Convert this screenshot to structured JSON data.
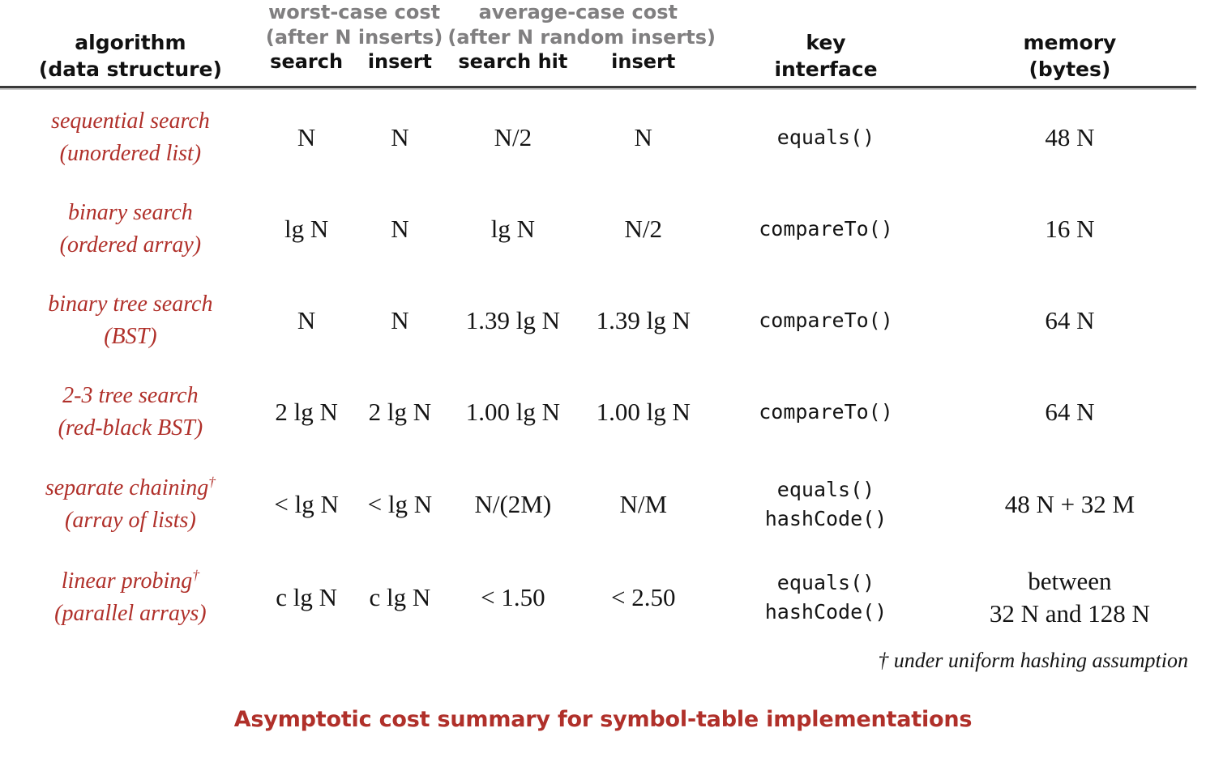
{
  "table": {
    "columns": {
      "algorithm": {
        "line1": "algorithm",
        "line2": "(data structure)"
      },
      "worst_case": {
        "title": "worst-case cost",
        "subtitle": "(after N inserts)"
      },
      "average_case": {
        "title": "average-case cost",
        "subtitle": "(after N random inserts)"
      },
      "worst_search": "search",
      "worst_insert": "insert",
      "avg_search_hit": "search hit",
      "avg_insert": "insert",
      "key_interface": {
        "line1": "key",
        "line2": "interface"
      },
      "memory": {
        "line1": "memory",
        "line2": "(bytes)"
      }
    },
    "rows": [
      {
        "algorithm": "sequential search",
        "structure": "(unordered list)",
        "dagger": "",
        "worst_search": "N",
        "worst_search_italic": "N",
        "worst_insert": "N",
        "avg_search_hit": "N/2",
        "avg_insert": "N",
        "key_interface_1": "equals()",
        "key_interface_2": "",
        "memory_1": "48 N",
        "memory_2": ""
      },
      {
        "algorithm": "binary search",
        "structure": "(ordered array)",
        "dagger": "",
        "worst_search": "lg N",
        "worst_insert": "N",
        "avg_search_hit": "lg N",
        "avg_insert": "N/2",
        "key_interface_1": "compareTo()",
        "key_interface_2": "",
        "memory_1": "16 N",
        "memory_2": ""
      },
      {
        "algorithm": "binary tree search",
        "structure": "(BST)",
        "dagger": "",
        "worst_search": "N",
        "worst_insert": "N",
        "avg_search_hit": "1.39 lg N",
        "avg_insert": "1.39 lg N",
        "key_interface_1": "compareTo()",
        "key_interface_2": "",
        "memory_1": "64 N",
        "memory_2": ""
      },
      {
        "algorithm": "2-3 tree search",
        "structure": "(red-black BST)",
        "dagger": "",
        "worst_search": "2 lg N",
        "worst_insert": "2 lg N",
        "avg_search_hit": "1.00 lg N",
        "avg_insert": "1.00 lg N",
        "key_interface_1": "compareTo()",
        "key_interface_2": "",
        "memory_1": "64 N",
        "memory_2": ""
      },
      {
        "algorithm": "separate chaining",
        "structure": "(array of lists)",
        "dagger": "†",
        "worst_search": "< lg N",
        "worst_insert": "< lg N",
        "avg_search_hit": "N/(2M)",
        "avg_insert": "N/M",
        "key_interface_1": "equals()",
        "key_interface_2": "hashCode()",
        "memory_1": "48 N + 32 M",
        "memory_2": ""
      },
      {
        "algorithm": "linear probing",
        "structure": "(parallel arrays)",
        "dagger": "†",
        "worst_search": "c lg N",
        "worst_insert": "c lg N",
        "avg_search_hit": "< 1.50",
        "avg_insert": "< 2.50",
        "key_interface_1": "equals()",
        "key_interface_2": "hashCode()",
        "memory_1": "between",
        "memory_2": "32 N and 128 N"
      }
    ]
  },
  "footnote": "† under uniform hashing assumption",
  "caption": "Asymptotic cost summary for symbol-table implementations",
  "colors": {
    "accent_red": "#b0302a",
    "header_gray": "#807f80",
    "text_black": "#141414",
    "rule": "#3a3a3a"
  }
}
